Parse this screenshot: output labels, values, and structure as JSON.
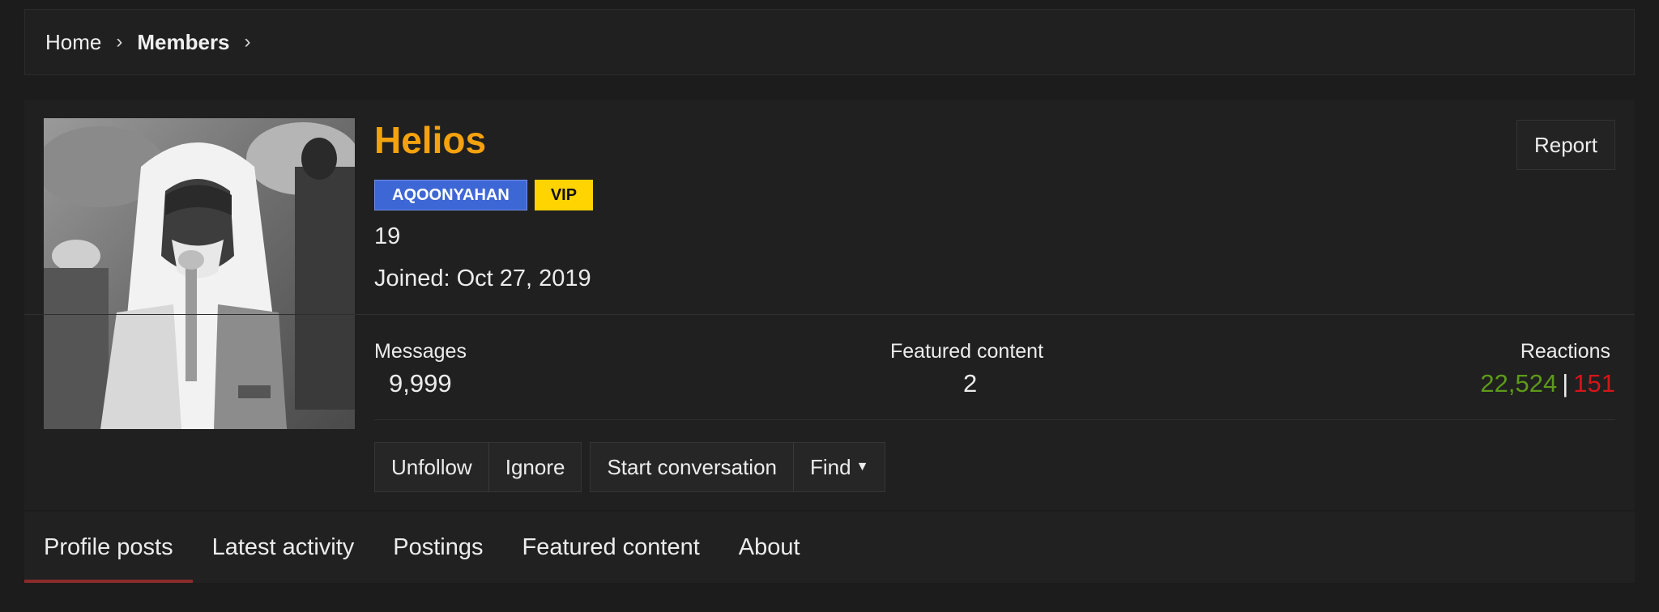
{
  "breadcrumb": {
    "home": "Home",
    "members": "Members"
  },
  "profile": {
    "name": "Helios",
    "banners": [
      "AQOONYAHAN",
      "VIP"
    ],
    "user_title": "19",
    "joined": "Joined: Oct 27, 2019",
    "report_label": "Report"
  },
  "stats": {
    "messages_label": "Messages",
    "messages_value": "9,999",
    "featured_label": "Featured content",
    "featured_value": "2",
    "reactions_label": "Reactions",
    "reactions_positive": "22,524",
    "reactions_separator": "|",
    "reactions_negative": "151"
  },
  "actions": {
    "unfollow": "Unfollow",
    "ignore": "Ignore",
    "start_conversation": "Start conversation",
    "find": "Find"
  },
  "tabs": [
    "Profile posts",
    "Latest activity",
    "Postings",
    "Featured content",
    "About"
  ],
  "colors": {
    "username": "#f5a20f",
    "banner_blue": "#3e67d6",
    "banner_vip": "#ffd400",
    "reactions_positive": "#5e9a1a",
    "reactions_negative": "#d7141a",
    "active_tab_underline": "#8a2b2b"
  },
  "icons": {
    "breadcrumb_separator": "chevron-right-icon",
    "find_dropdown": "caret-down-icon"
  }
}
